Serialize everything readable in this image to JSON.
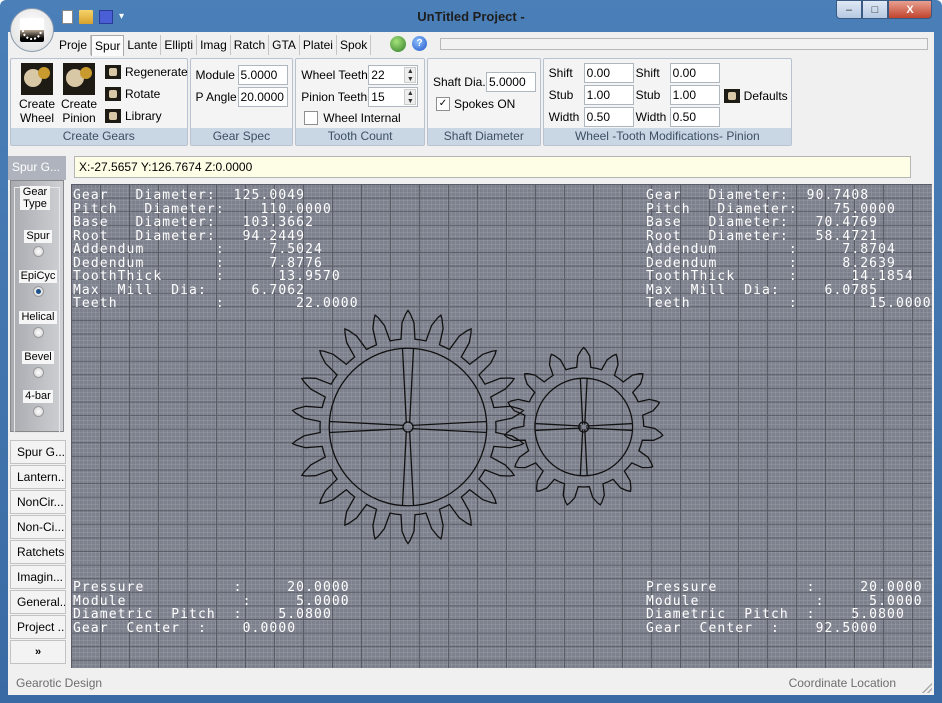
{
  "window": {
    "title": "UnTitled Project -",
    "controls": {
      "minimize": "–",
      "maximize": "□",
      "close": "X"
    }
  },
  "quick_access": [
    "new-file-icon",
    "open-folder-icon",
    "save-icon",
    "customize-dropdown-icon"
  ],
  "tabs": [
    {
      "label": "Proje",
      "active": false
    },
    {
      "label": "Spur",
      "active": true
    },
    {
      "label": "Lante",
      "active": false
    },
    {
      "label": "Ellipti",
      "active": false
    },
    {
      "label": "Imag",
      "active": false
    },
    {
      "label": "Ratch",
      "active": false
    },
    {
      "label": "GTA",
      "active": false
    },
    {
      "label": "Platei",
      "active": false
    },
    {
      "label": "Spok",
      "active": false
    }
  ],
  "ribbon": {
    "create_gears": {
      "label": "Create Gears",
      "create_wheel": "Create Wheel",
      "create_pinion": "Create Pinion",
      "regenerate": "Regenerate",
      "rotate": "Rotate",
      "library": "Library"
    },
    "gear_spec": {
      "label": "Gear Spec",
      "module_label": "Module",
      "module_value": "5.0000",
      "pangle_label": "P Angle",
      "pangle_value": "20.0000"
    },
    "tooth_count": {
      "label": "Tooth Count",
      "wheel_teeth_label": "Wheel Teeth",
      "wheel_teeth_value": "22",
      "pinion_teeth_label": "Pinion Teeth",
      "pinion_teeth_value": "15",
      "wheel_internal_label": "Wheel Internal",
      "wheel_internal_checked": false
    },
    "shaft_diameter": {
      "label": "Shaft Diameter",
      "shaft_dia_label": "Shaft Dia.",
      "shaft_dia_value": "5.0000",
      "spokes_label": "Spokes ON",
      "spokes_checked": true
    },
    "tooth_mods": {
      "label": "Wheel -Tooth Modifications- Pinion",
      "wheel": {
        "shift_label": "Shift",
        "shift": "0.00",
        "stub_label": "Stub",
        "stub": "1.00",
        "width_label": "Width",
        "width": "0.50"
      },
      "pinion": {
        "shift_label": "Shift",
        "shift": "0.00",
        "stub_label": "Stub",
        "stub": "1.00",
        "width_label": "Width",
        "width": "0.50"
      },
      "defaults": "Defaults"
    }
  },
  "coordinate_readout": "X:-27.5657 Y:126.7674 Z:0.0000",
  "side_panel": {
    "title": "Spur G...",
    "gear_type_legend": "Gear Type",
    "gear_types": [
      {
        "label": "Spur",
        "checked": false
      },
      {
        "label": "EpiCyc",
        "checked": true
      },
      {
        "label": "Helical",
        "checked": false
      },
      {
        "label": "Bevel",
        "checked": false
      },
      {
        "label": "4-bar",
        "checked": false
      }
    ],
    "nav_buttons": [
      "Spur G...",
      "Lantern...",
      "NonCir...",
      "Non-Ci...",
      "Ratchets",
      "Imagin...",
      "General...",
      "Project ...",
      "»"
    ]
  },
  "canvas": {
    "wheel_info": [
      "Gear   Diameter:  125.0049",
      "Pitch   Diameter:    110.0000",
      "Base   Diameter:   103.3662",
      "Root   Diameter:   94.2449",
      "Addendum        :     7.5024",
      "Dedendum        :     7.8776",
      "ToothThick      :      13.9570",
      "Max  Mill  Dia:     6.7062",
      "Teeth           :        22.0000"
    ],
    "pinion_info": [
      "Gear   Diameter:  90.7408",
      "Pitch   Diameter:    75.0000",
      "Base   Diameter:   70.4769",
      "Root   Diameter:   58.4721",
      "Addendum        :     7.8704",
      "Dedendum        :     8.2639",
      "ToothThick      :      14.1854",
      "Max  Mill  Dia:     6.0785",
      "Teeth           :        15.0000"
    ],
    "wheel_footer": [
      "Pressure          :     20.0000",
      "Module             :     5.0000",
      "Diametric  Pitch  :    5.0800",
      "Gear  Center  :    0.0000"
    ],
    "pinion_footer": [
      "Pressure          :     20.0000",
      "Module             :     5.0000",
      "Diametric  Pitch  :    5.0800",
      "Gear  Center  :    92.5000"
    ],
    "wheel_teeth": 22,
    "pinion_teeth": 15,
    "wheel_pitch_diameter": 110.0,
    "pinion_pitch_diameter": 75.0,
    "center_distance": 92.5
  },
  "status": {
    "left": "Gearotic Design",
    "right": "Coordinate Location"
  }
}
